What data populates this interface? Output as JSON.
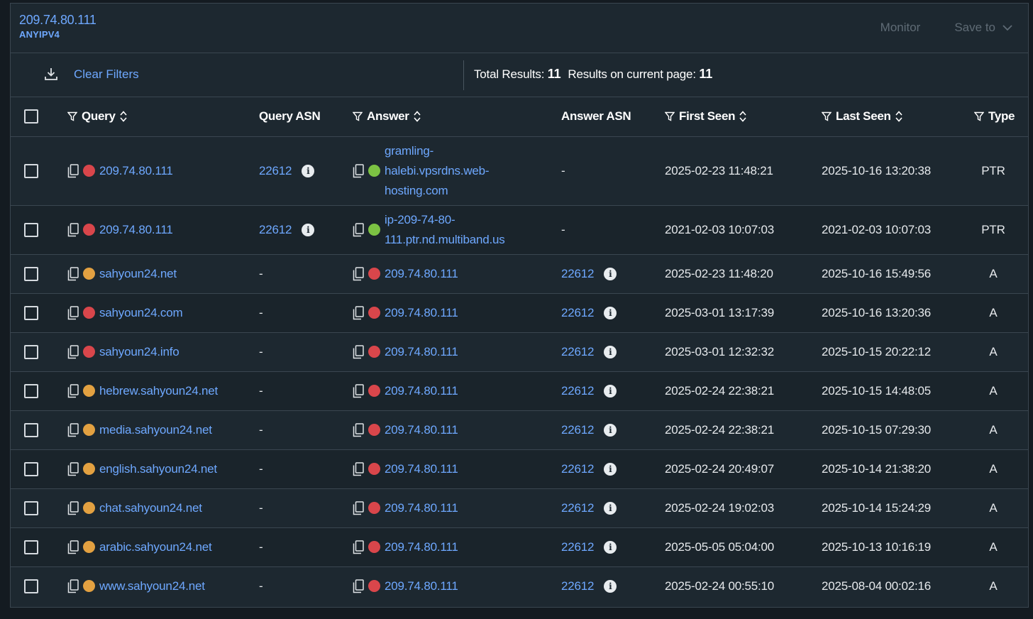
{
  "header": {
    "ip": "209.74.80.111",
    "type": "ANYIPV4",
    "monitor_label": "Monitor",
    "save_label": "Save to"
  },
  "toolbar": {
    "clear_label": "Clear Filters",
    "total_label": "Total Results:",
    "total_value": "11",
    "page_label": "Results on current page:",
    "page_value": "11"
  },
  "columns": {
    "query": "Query",
    "query_asn": "Query ASN",
    "answer": "Answer",
    "answer_asn": "Answer ASN",
    "first_seen": "First Seen",
    "last_seen": "Last Seen",
    "type": "Type"
  },
  "rows": [
    {
      "query": "209.74.80.111",
      "query_dot": "red",
      "query_asn": "22612",
      "answer_lines": [
        "gramling-",
        "halebi.vpsrdns.web-",
        "hosting.com"
      ],
      "answer_dot": "green",
      "answer_asn": "-",
      "first_seen": "2025-02-23 11:48:21",
      "last_seen": "2025-10-16 13:20:38",
      "type": "PTR"
    },
    {
      "query": "209.74.80.111",
      "query_dot": "red",
      "query_asn": "22612",
      "answer_lines": [
        "ip-209-74-80-",
        "111.ptr.nd.multiband.us"
      ],
      "answer_dot": "green",
      "answer_asn": "-",
      "first_seen": "2021-02-03 10:07:03",
      "last_seen": "2021-02-03 10:07:03",
      "type": "PTR"
    },
    {
      "query": "sahyoun24.net",
      "query_dot": "orange",
      "query_asn": "-",
      "answer_lines": [
        "209.74.80.111"
      ],
      "answer_dot": "red",
      "answer_asn": "22612",
      "first_seen": "2025-02-23 11:48:20",
      "last_seen": "2025-10-16 15:49:56",
      "type": "A"
    },
    {
      "query": "sahyoun24.com",
      "query_dot": "red",
      "query_asn": "-",
      "answer_lines": [
        "209.74.80.111"
      ],
      "answer_dot": "red",
      "answer_asn": "22612",
      "first_seen": "2025-03-01 13:17:39",
      "last_seen": "2025-10-16 13:20:36",
      "type": "A"
    },
    {
      "query": "sahyoun24.info",
      "query_dot": "red",
      "query_asn": "-",
      "answer_lines": [
        "209.74.80.111"
      ],
      "answer_dot": "red",
      "answer_asn": "22612",
      "first_seen": "2025-03-01 12:32:32",
      "last_seen": "2025-10-15 20:22:12",
      "type": "A"
    },
    {
      "query": "hebrew.sahyoun24.net",
      "query_dot": "orange",
      "query_asn": "-",
      "answer_lines": [
        "209.74.80.111"
      ],
      "answer_dot": "red",
      "answer_asn": "22612",
      "first_seen": "2025-02-24 22:38:21",
      "last_seen": "2025-10-15 14:48:05",
      "type": "A"
    },
    {
      "query": "media.sahyoun24.net",
      "query_dot": "orange",
      "query_asn": "-",
      "answer_lines": [
        "209.74.80.111"
      ],
      "answer_dot": "red",
      "answer_asn": "22612",
      "first_seen": "2025-02-24 22:38:21",
      "last_seen": "2025-10-15 07:29:30",
      "type": "A"
    },
    {
      "query": "english.sahyoun24.net",
      "query_dot": "orange",
      "query_asn": "-",
      "answer_lines": [
        "209.74.80.111"
      ],
      "answer_dot": "red",
      "answer_asn": "22612",
      "first_seen": "2025-02-24 20:49:07",
      "last_seen": "2025-10-14 21:38:20",
      "type": "A"
    },
    {
      "query": "chat.sahyoun24.net",
      "query_dot": "orange",
      "query_asn": "-",
      "answer_lines": [
        "209.74.80.111"
      ],
      "answer_dot": "red",
      "answer_asn": "22612",
      "first_seen": "2025-02-24 19:02:03",
      "last_seen": "2025-10-14 15:24:29",
      "type": "A"
    },
    {
      "query": "arabic.sahyoun24.net",
      "query_dot": "orange",
      "query_asn": "-",
      "answer_lines": [
        "209.74.80.111"
      ],
      "answer_dot": "red",
      "answer_asn": "22612",
      "first_seen": "2025-05-05 05:04:00",
      "last_seen": "2025-10-13 10:16:19",
      "type": "A"
    },
    {
      "query": "www.sahyoun24.net",
      "query_dot": "orange",
      "query_asn": "-",
      "answer_lines": [
        "209.74.80.111"
      ],
      "answer_dot": "red",
      "answer_asn": "22612",
      "first_seen": "2025-02-24 00:55:10",
      "last_seen": "2025-08-04 00:02:16",
      "type": "A"
    }
  ],
  "icons": {
    "info_glyph": "i",
    "status_colors": {
      "red": "#d9464b",
      "orange": "#e3a141",
      "green": "#7cc243"
    },
    "link_color": "#6ea8ff"
  }
}
